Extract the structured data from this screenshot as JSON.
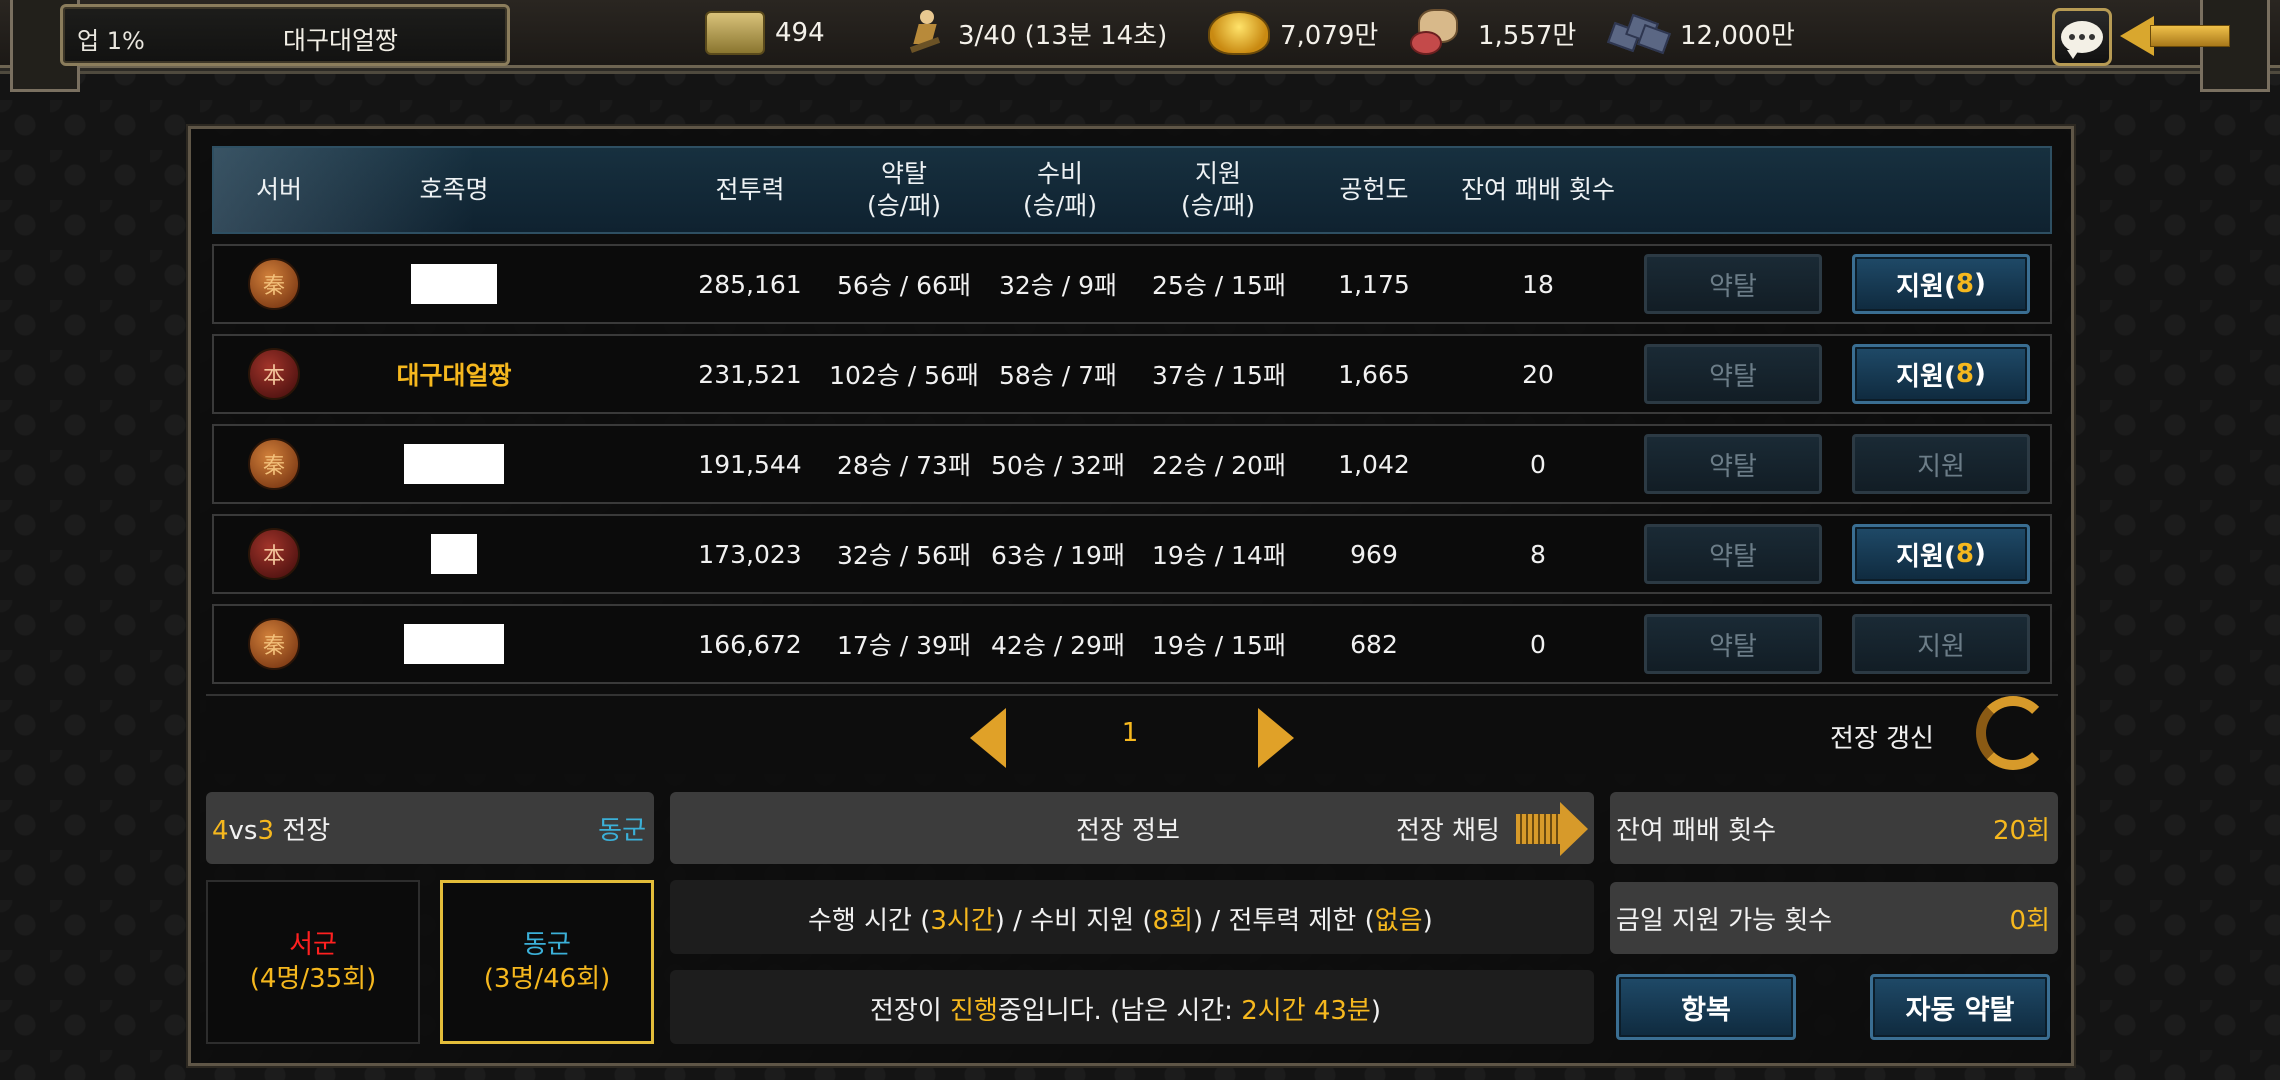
{
  "top_bar": {
    "rank": "업 1%",
    "alliance_name": "대구대얼짱",
    "resources": [
      {
        "icon": "scroll-icon",
        "value": "494"
      },
      {
        "icon": "runner-icon",
        "value": "3/40 (13분 14초)"
      },
      {
        "icon": "gold-ingot-icon",
        "value": "7,079만"
      },
      {
        "icon": "food-icon",
        "value": "1,557만"
      },
      {
        "icon": "iron-ore-icon",
        "value": "12,000만"
      }
    ]
  },
  "table": {
    "headers": {
      "server": "서버",
      "clan": "호족명",
      "power": "전투력",
      "plunder_1": "약탈",
      "plunder_2": "(승/패)",
      "defense_1": "수비",
      "defense_2": "(승/패)",
      "support_1": "지원",
      "support_2": "(승/패)",
      "contribution": "공헌도",
      "remaining_defeats": "잔여 패배 횟수"
    },
    "rows": [
      {
        "server_badge": "秦",
        "name": "",
        "power": "285,161",
        "plunder": "56승 / 66패",
        "defense": "32승 / 9패",
        "support": "25승 / 15패",
        "contribution": "1,175",
        "remaining": "18",
        "plunder_btn": "약탈",
        "support_btn": "지원(",
        "support_count": "8",
        "support_btn_end": ")"
      },
      {
        "server_badge": "本",
        "name": "대구대얼짱",
        "power": "231,521",
        "plunder": "102승 / 56패",
        "defense": "58승 / 7패",
        "support": "37승 / 15패",
        "contribution": "1,665",
        "remaining": "20",
        "plunder_btn": "약탈",
        "support_btn": "지원(",
        "support_count": "8",
        "support_btn_end": ")"
      },
      {
        "server_badge": "秦",
        "name": "",
        "power": "191,544",
        "plunder": "28승 / 73패",
        "defense": "50승 / 32패",
        "support": "22승 / 20패",
        "contribution": "1,042",
        "remaining": "0",
        "plunder_btn": "약탈",
        "support_btn": "지원"
      },
      {
        "server_badge": "本",
        "name": "",
        "power": "173,023",
        "plunder": "32승 / 56패",
        "defense": "63승 / 19패",
        "support": "19승 / 14패",
        "contribution": "969",
        "remaining": "8",
        "plunder_btn": "약탈",
        "support_btn": "지원(",
        "support_count": "8",
        "support_btn_end": ")"
      },
      {
        "server_badge": "秦",
        "name": "",
        "power": "166,672",
        "plunder": "17승 / 39패",
        "defense": "42승 / 29패",
        "support": "19승 / 15패",
        "contribution": "682",
        "remaining": "0",
        "plunder_btn": "약탈",
        "support_btn": "지원"
      }
    ]
  },
  "pagination": {
    "page": "1",
    "refresh_label": "전장 갱신"
  },
  "battle": {
    "format_a": "4",
    "format_vs": "vs",
    "format_b": "3",
    "format_suffix": " 전장",
    "side": "동군",
    "info_label": "전장 정보",
    "chat_label": "전장 채팅",
    "remaining_defeats_label": "잔여 패배 횟수",
    "remaining_defeats_value": "20회",
    "support_today_label": "금일 지원 가능 횟수",
    "support_today_value": "0회",
    "rules": {
      "p1": "수행 시간 (",
      "duration": "3시간",
      "p2": ") / 수비 지원 (",
      "support": "8회",
      "p3": ") / 전투력 제한 (",
      "limit": "없음",
      "p4": ")"
    },
    "status": {
      "p1": "전장이 ",
      "state": "진행",
      "p2": "중입니다. (남은 시간: ",
      "time": "2시간 43분",
      "p3": ")"
    },
    "west": {
      "name": "서군",
      "open": "(",
      "members": "4명",
      "slash": "/",
      "count": "35회",
      "close": ")"
    },
    "east": {
      "name": "동군",
      "open": "(",
      "members": "3명",
      "slash": "/",
      "count": "46회",
      "close": ")"
    },
    "surrender_btn": "항복",
    "auto_plunder_btn": "자동 약탈"
  }
}
